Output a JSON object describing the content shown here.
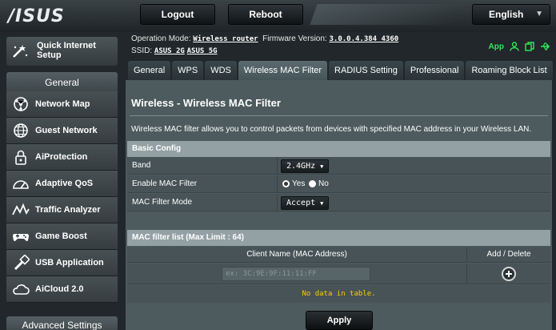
{
  "brand": {
    "logo": "/ISUS"
  },
  "topbar": {
    "logout": "Logout",
    "reboot": "Reboot",
    "language": "English"
  },
  "sidebar": {
    "quick_setup": "Quick Internet Setup",
    "section_general": "General",
    "items": [
      {
        "label": "Network Map",
        "icon": "network-map-icon"
      },
      {
        "label": "Guest Network",
        "icon": "guest-network-icon"
      },
      {
        "label": "AiProtection",
        "icon": "aiprotection-lock-icon"
      },
      {
        "label": "Adaptive QoS",
        "icon": "qos-gauge-icon"
      },
      {
        "label": "Traffic Analyzer",
        "icon": "traffic-analyzer-icon"
      },
      {
        "label": "Game Boost",
        "icon": "gamepad-icon"
      },
      {
        "label": "USB Application",
        "icon": "usb-icon"
      },
      {
        "label": "AiCloud 2.0",
        "icon": "cloud-icon"
      }
    ],
    "section_advanced": "Advanced Settings"
  },
  "header": {
    "operation_mode_label": "Operation Mode:",
    "operation_mode_value": "Wireless router",
    "firmware_label": "Firmware Version:",
    "firmware_value": "3.0.0.4.384_4360",
    "ssid_label": "SSID:",
    "ssid_2g": "ASUS_2G",
    "ssid_5g": "ASUS_5G",
    "app_label": "App",
    "status_color": "#33e85a"
  },
  "tabs": [
    {
      "label": "General",
      "active": false
    },
    {
      "label": "WPS",
      "active": false
    },
    {
      "label": "WDS",
      "active": false
    },
    {
      "label": "Wireless MAC Filter",
      "active": true
    },
    {
      "label": "RADIUS Setting",
      "active": false
    },
    {
      "label": "Professional",
      "active": false
    },
    {
      "label": "Roaming Block List",
      "active": false
    }
  ],
  "main": {
    "title": "Wireless - Wireless MAC Filter",
    "description": "Wireless MAC filter allows you to control packets from devices with specified MAC address in your Wireless LAN.",
    "basic_config": {
      "header": "Basic Config",
      "band_label": "Band",
      "band_value": "2.4GHz",
      "enable_label": "Enable MAC Filter",
      "enable_yes": "Yes",
      "enable_no": "No",
      "enable_selected": "Yes",
      "mode_label": "MAC Filter Mode",
      "mode_value": "Accept"
    },
    "mac_list": {
      "header": "MAC filter list (Max Limit : 64)",
      "col_client": "Client Name (MAC Address)",
      "col_action": "Add / Delete",
      "input_placeholder": "ex: 3C:9E:9F:11:11:FF",
      "empty_text": "No data in table."
    },
    "apply": "Apply"
  }
}
